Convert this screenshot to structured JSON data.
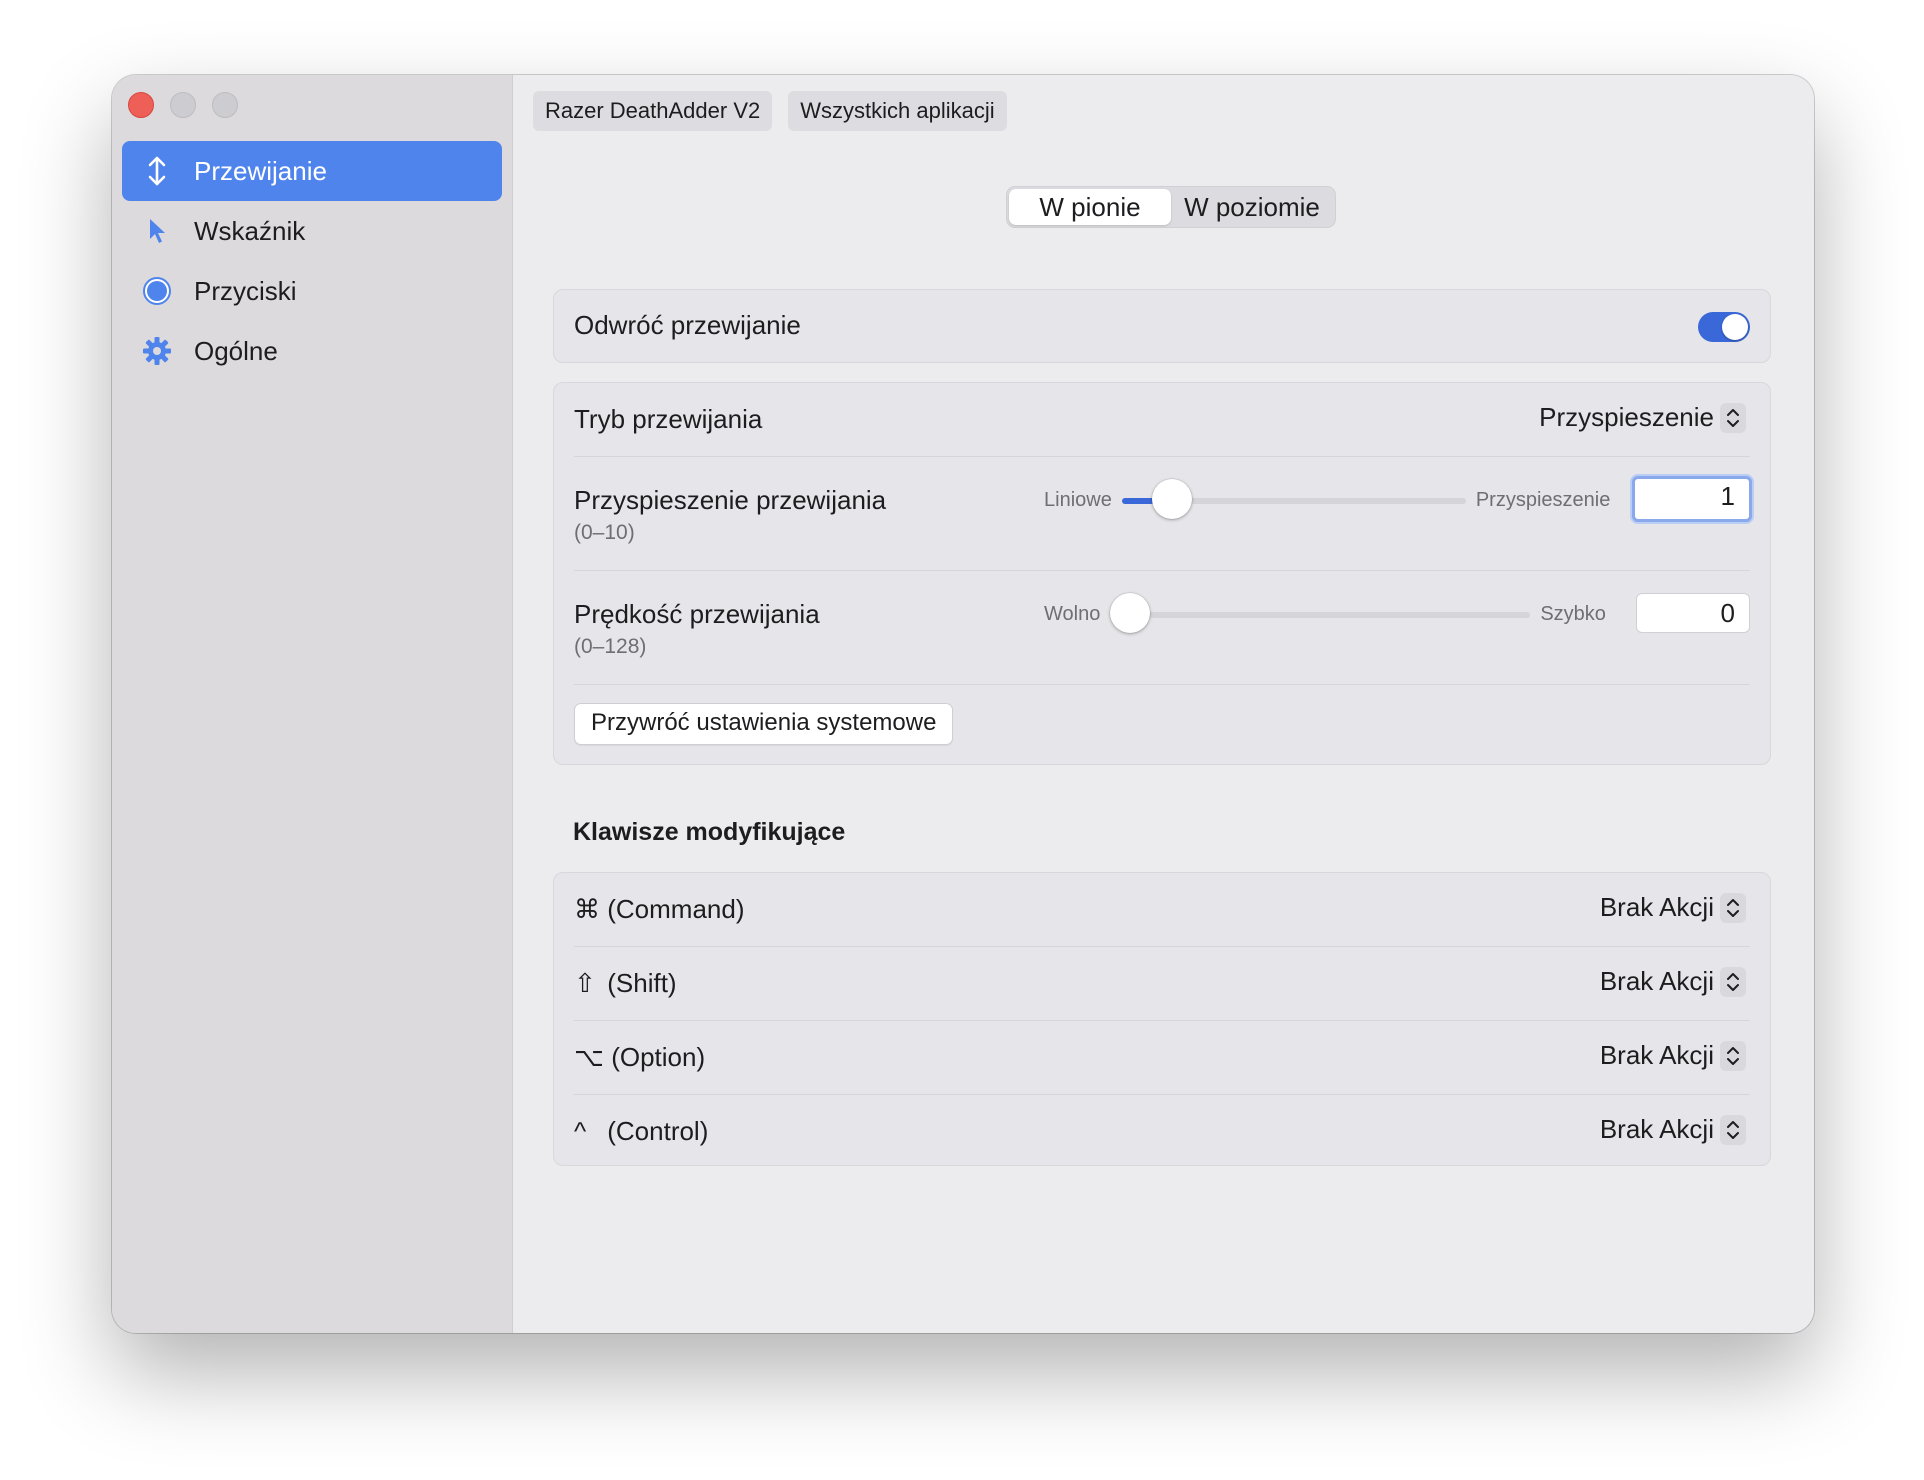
{
  "sidebar": {
    "items": [
      {
        "label": "Przewijanie",
        "icon": "arrow-up-down-icon",
        "active": true
      },
      {
        "label": "Wskaźnik",
        "icon": "pointer-arrow-icon",
        "active": false
      },
      {
        "label": "Przyciski",
        "icon": "circle-button-icon",
        "active": false
      },
      {
        "label": "Ogólne",
        "icon": "gear-icon",
        "active": false
      }
    ]
  },
  "header": {
    "device": "Razer DeathAdder V2",
    "app_scope": "Wszystkich aplikacji"
  },
  "direction": {
    "vertical": "W pionie",
    "horizontal": "W poziomie",
    "selected": "W pionie"
  },
  "scroll": {
    "reverse_label": "Odwróć przewijanie",
    "reverse_on": true,
    "mode_label": "Tryb przewijania",
    "mode_value": "Przyspieszenie",
    "accel": {
      "label": "Przyspieszenie przewijania",
      "range": "(0–10)",
      "min_label": "Liniowe",
      "max_label": "Przyspieszenie",
      "value": "1",
      "fraction": 0.1
    },
    "speed": {
      "label": "Prędkość przewijania",
      "range": "(0–128)",
      "min_label": "Wolno",
      "max_label": "Szybko",
      "value": "0",
      "fraction": 0
    },
    "reset_button": "Przywróć ustawienia systemowe"
  },
  "modifiers": {
    "title": "Klawisze modyfikujące",
    "rows": [
      {
        "symbol": "⌘",
        "label": "(Command)",
        "value": "Brak Akcji"
      },
      {
        "symbol": "⇧",
        "label": "(Shift)",
        "value": "Brak Akcji"
      },
      {
        "symbol": "⌥",
        "label": "(Option)",
        "value": "Brak Akcji"
      },
      {
        "symbol": "^",
        "label": "(Control)",
        "value": "Brak Akcji"
      }
    ]
  },
  "colors": {
    "accent": "#3a68d8",
    "sidebar_selected": "#4f84ed",
    "close_button": "#ee5f57"
  }
}
